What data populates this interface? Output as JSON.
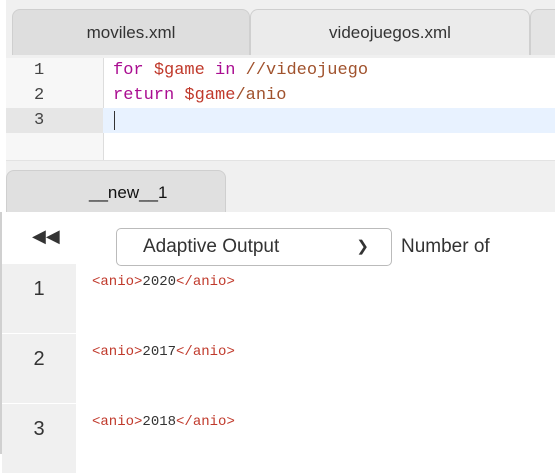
{
  "editor_tabs": [
    {
      "label": "moviles.xml"
    },
    {
      "label": "videojuegos.xml"
    },
    {
      "label": ""
    }
  ],
  "editor": {
    "lines": [
      {
        "number": "1",
        "keyword": "for",
        "var": "$game",
        "rest_kw": "in",
        "path": "//videojuego"
      },
      {
        "number": "2",
        "keyword": "return",
        "var": "$game",
        "path": "/anio"
      },
      {
        "number": "3"
      }
    ]
  },
  "result_tab": {
    "label": "__new__1"
  },
  "toolbar": {
    "collapse_icon": "double-left-arrow-icon",
    "output_mode": "Adaptive Output",
    "number_label": "Number of"
  },
  "results": [
    {
      "index": "1",
      "open": "<anio>",
      "value": "2020",
      "close": "</anio>"
    },
    {
      "index": "2",
      "open": "<anio>",
      "value": "2017",
      "close": "</anio>"
    },
    {
      "index": "3",
      "open": "<anio>",
      "value": "2018",
      "close": "</anio>"
    }
  ]
}
